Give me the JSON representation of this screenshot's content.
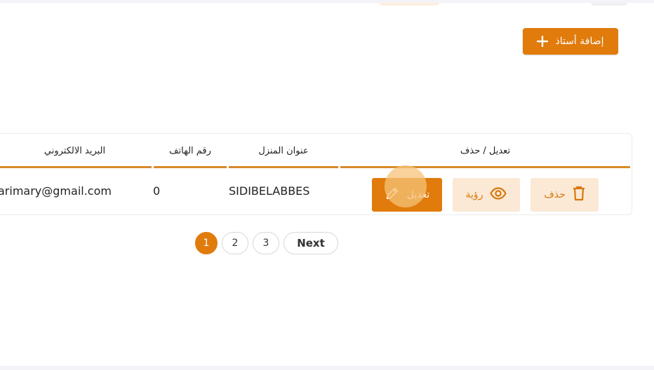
{
  "toolbar": {
    "add_teacher_label": "إضافة أستاذ"
  },
  "table": {
    "headers": {
      "email": "البريد الالكتروني",
      "phone": "رقم الهاتف",
      "address": "عنوان المنزل",
      "actions": "تعديل / حذف"
    },
    "rows": [
      {
        "email": "arimary@gmail.com",
        "phone": "0",
        "address": "SIDIBELABBES"
      }
    ],
    "actions": {
      "edit": "تعديل",
      "view": "رؤية",
      "delete": "حذف"
    }
  },
  "pagination": {
    "pages": [
      "1",
      "2",
      "3"
    ],
    "current": "1",
    "next": "Next"
  },
  "colors": {
    "accent": "#e07b0c",
    "accent_soft": "#fbe9d6",
    "header_underline": "#d98a2a"
  },
  "icons": {
    "add": "plus-icon",
    "edit": "pencil-icon",
    "view": "eye-icon",
    "delete": "trash-icon"
  }
}
